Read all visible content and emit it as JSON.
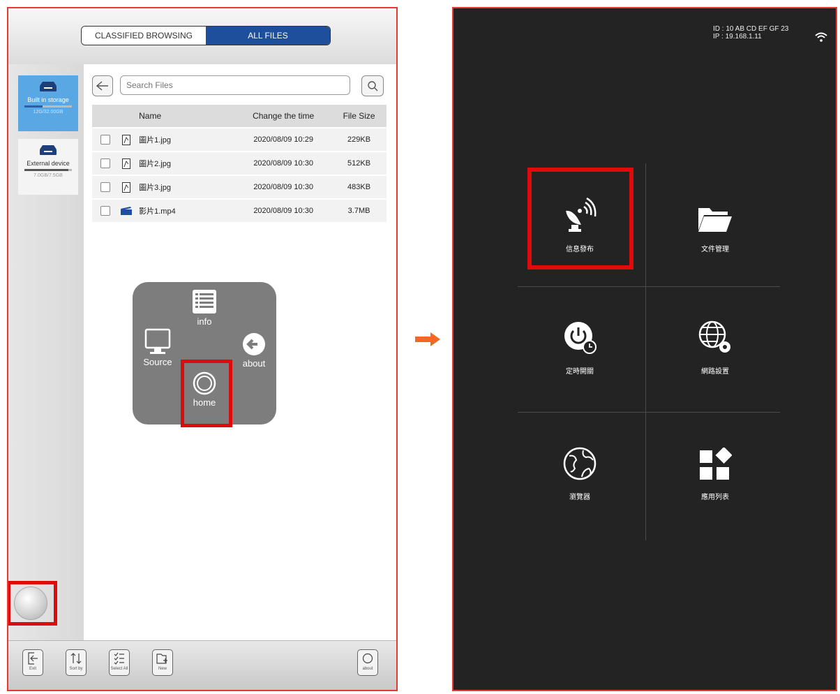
{
  "left_app": {
    "segmented_tabs": [
      "CLASSIFIED BROWSING",
      "ALL FILES"
    ],
    "sidebar": {
      "items": [
        {
          "label": "Built in storage",
          "capacity": "12G/32.00GB",
          "usage_fraction": 0.38,
          "icon": "drive-icon"
        },
        {
          "label": "External device",
          "capacity": "7.0GB/7.5GB",
          "usage_fraction": 0.93,
          "icon": "drive-icon"
        }
      ]
    },
    "search": {
      "placeholder": "Search Files"
    },
    "table": {
      "headers": {
        "name": "Name",
        "time": "Change the time",
        "size": "File Size"
      },
      "rows": [
        {
          "name": "圖片1.jpg",
          "time": "2020/08/09 10:29",
          "size": "229KB",
          "type": "image"
        },
        {
          "name": "圖片2.jpg",
          "time": "2020/08/09 10:30",
          "size": "512KB",
          "type": "image"
        },
        {
          "name": "圖片3.jpg",
          "time": "2020/08/09 10:30",
          "size": "483KB",
          "type": "image"
        },
        {
          "name": "影片1.mp4",
          "time": "2020/08/09 10:30",
          "size": "3.7MB",
          "type": "video"
        }
      ]
    },
    "quick_menu": {
      "info": "info",
      "source": "Source",
      "about": "about",
      "home": "home"
    },
    "bottom_toolbar": {
      "exit": "Exit",
      "sort_by": "Sort by",
      "select_all": "Select All",
      "new": "New",
      "about": "about"
    }
  },
  "right_app": {
    "device_info": {
      "id_line": "ID : 10 AB CD EF GF 23",
      "ip_line": "IP : 19.168.1.11"
    },
    "tiles": [
      {
        "label": "信息發布",
        "icon": "satellite-dish-icon"
      },
      {
        "label": "文件管理",
        "icon": "folder-icon"
      },
      {
        "label": "定時開關",
        "icon": "power-timer-icon"
      },
      {
        "label": "網路設置",
        "icon": "globe-gear-icon"
      },
      {
        "label": "瀏覽器",
        "icon": "earth-icon"
      },
      {
        "label": "應用列表",
        "icon": "apps-icon"
      }
    ]
  },
  "colors": {
    "highlight_red": "#dd0c0c",
    "tab_blue": "#1e4f9c",
    "storage_blue": "#59a7e3",
    "dark_bg": "#232323",
    "arrow_orange": "#f06a21"
  }
}
